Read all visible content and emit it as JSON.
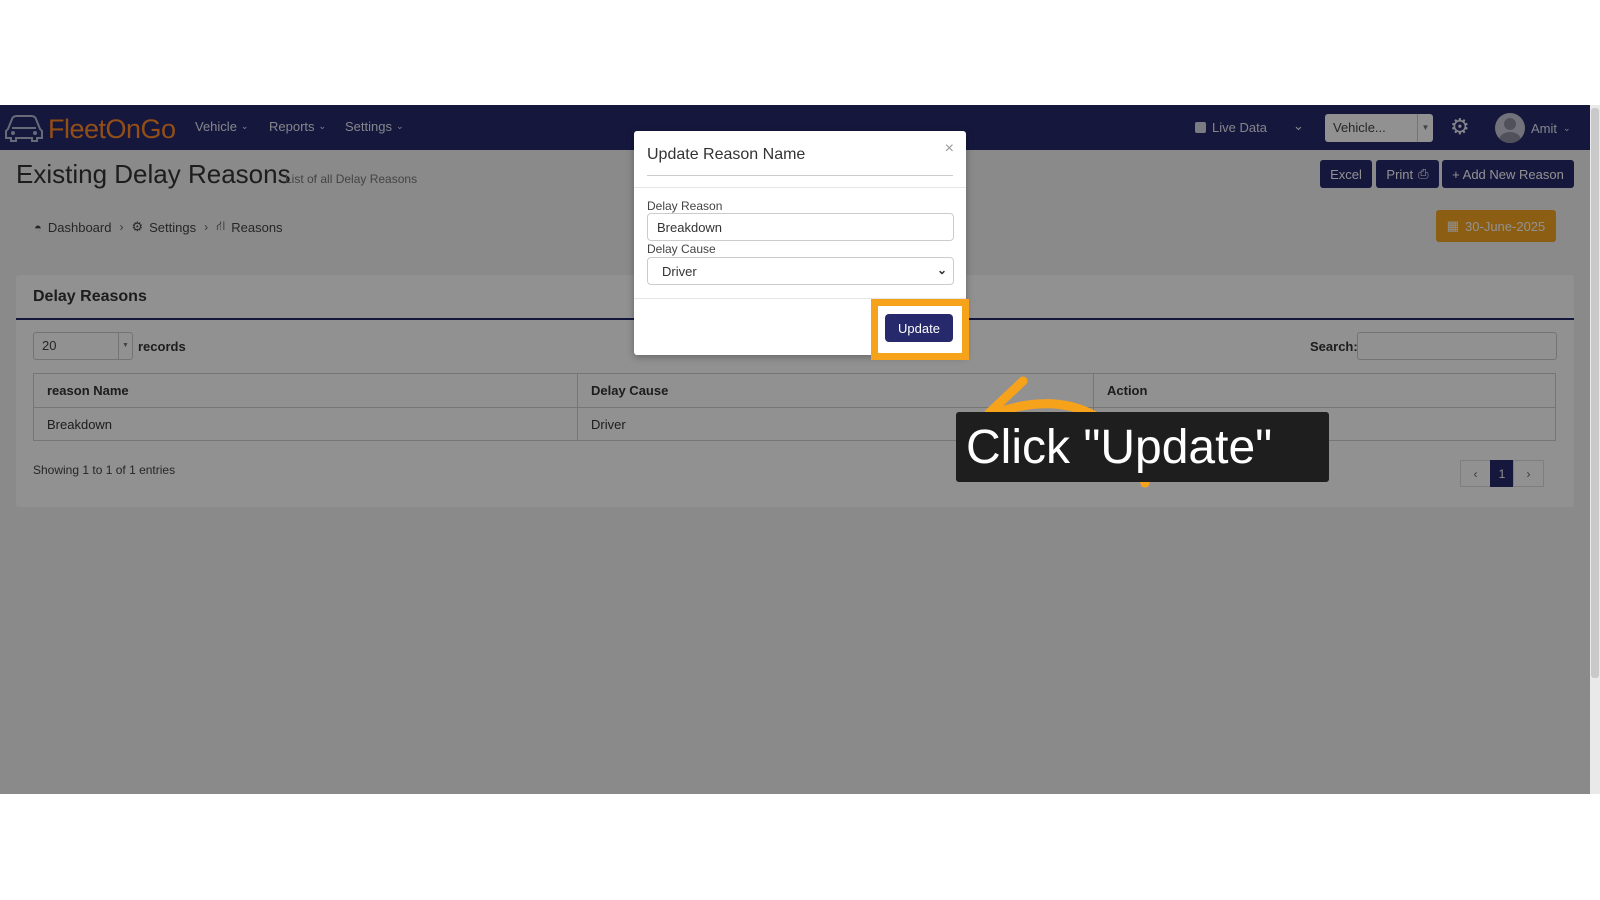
{
  "app": {
    "brand": "FleetOnGo",
    "nav": [
      {
        "label": "Vehicle"
      },
      {
        "label": "Reports"
      },
      {
        "label": "Settings"
      }
    ],
    "live_data_label": "Live Data",
    "vehicle_select_value": "Vehicle...",
    "user_name": "Amit"
  },
  "page": {
    "title": "Existing Delay Reasons",
    "subtitle": "List of all Delay Reasons",
    "buttons": {
      "excel": "Excel",
      "print": "Print",
      "add_new": "+ Add New Reason"
    },
    "breadcrumb": {
      "dashboard": "Dashboard",
      "settings": "Settings",
      "reasons": "Reasons"
    },
    "date": "30-June-2025"
  },
  "panel": {
    "title": "Delay Reasons",
    "page_length": "20",
    "records_label": "records",
    "search_label": "Search:",
    "search_value": "",
    "columns": [
      "reason Name",
      "Delay Cause",
      "Action"
    ],
    "rows": [
      {
        "reason_name": "Breakdown",
        "delay_cause": "Driver",
        "action": ""
      }
    ],
    "info": "Showing 1 to 1 of 1 entries",
    "pagination": {
      "prev": "‹",
      "current": "1",
      "next": "›"
    }
  },
  "modal": {
    "title": "Update Reason Name",
    "close": "×",
    "delay_reason_label": "Delay Reason",
    "delay_reason_value": "Breakdown",
    "delay_cause_label": "Delay Cause",
    "delay_cause_value": "Driver",
    "update_button": "Update"
  },
  "annotation": {
    "callout_text": "Click \"Update\"",
    "highlight_color": "#f7a21b"
  },
  "colors": {
    "primary": "#26296b",
    "accent": "#f5a623",
    "logo": "#ff8a2a"
  },
  "icons": {
    "logo": "car-icon",
    "dashboard": "dashboard-icon",
    "settings": "cogs-icon",
    "reasons": "road-icon",
    "calendar": "calendar-icon",
    "print": "print-icon",
    "gear": "gear-icon"
  }
}
